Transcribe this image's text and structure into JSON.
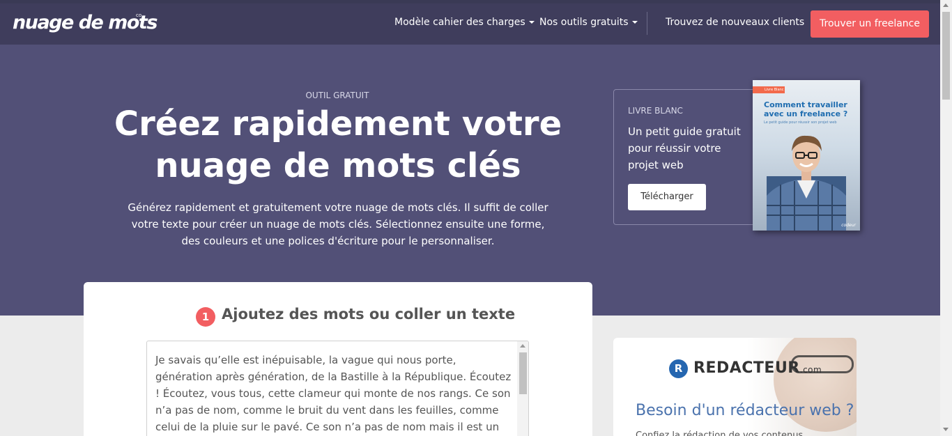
{
  "navbar": {
    "logo": "nuage de mots",
    "logo_suffix": "co",
    "items": [
      {
        "label": "Modèle cahier des charges",
        "has_dropdown": true
      },
      {
        "label": "Nos outils gratuits",
        "has_dropdown": true
      },
      {
        "label": "Trouvez de nouveaux clients",
        "has_dropdown": false
      }
    ],
    "cta_label": "Trouver un freelance"
  },
  "hero": {
    "eyebrow": "OUTIL GRATUIT",
    "title": "Créez rapidement votre nuage de mots clés",
    "description": "Générez rapidement et gratuitement votre nuage de mots clés. Il suffit de coller votre texte pour créer un nuage de mots clés. Sélectionnez ensuite une forme, des couleurs et une polices d'écriture pour le personnaliser."
  },
  "guide": {
    "eyebrow": "LIVRE BLANC",
    "title": "Un petit guide gratuit pour réussir votre projet web",
    "button_label": "Télécharger",
    "book": {
      "tag": "Livre Blanc",
      "title": "Comment travailler avec un freelance ?",
      "subtitle": "Le petit guide pour réussir son projet web",
      "brand": "codeur"
    }
  },
  "step1": {
    "number": "1",
    "title": "Ajoutez des mots ou coller un texte",
    "text": "Je savais qu’elle est inépuisable, la vague qui nous porte, génération après génération, de la Bastille à la République. Écoutez ! Écoutez, vous tous, cette clameur qui monte de nos rangs. Ce son n’a pas de nom, comme le bruit du vent dans les feuilles, comme celui de la pluie sur le pavé. Ce son n’a pas de nom mais il est un signal : celui"
  },
  "ad": {
    "brand_letter": "R",
    "brand_name": "REDACTEUR",
    "brand_tld": ".com",
    "title": "Besoin d'un rédacteur web ?",
    "body": "Confiez la rédaction de vos contenus"
  },
  "colors": {
    "navbar": "#3f3d5c",
    "hero": "#525077",
    "accent": "#f25e61",
    "page_bg": "#ececec"
  }
}
